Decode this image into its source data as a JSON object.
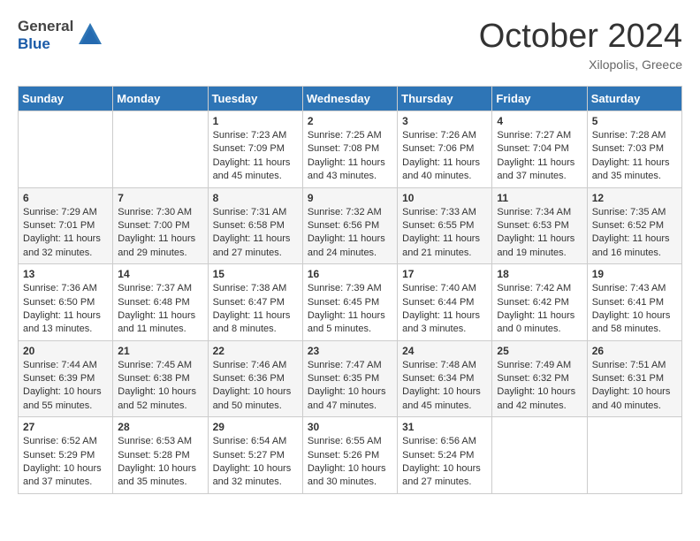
{
  "logo": {
    "general": "General",
    "blue": "Blue"
  },
  "title": {
    "month": "October 2024",
    "location": "Xilopolis, Greece"
  },
  "headers": [
    "Sunday",
    "Monday",
    "Tuesday",
    "Wednesday",
    "Thursday",
    "Friday",
    "Saturday"
  ],
  "weeks": [
    [
      {
        "day": "",
        "info": ""
      },
      {
        "day": "",
        "info": ""
      },
      {
        "day": "1",
        "info": "Sunrise: 7:23 AM\nSunset: 7:09 PM\nDaylight: 11 hours and 45 minutes."
      },
      {
        "day": "2",
        "info": "Sunrise: 7:25 AM\nSunset: 7:08 PM\nDaylight: 11 hours and 43 minutes."
      },
      {
        "day": "3",
        "info": "Sunrise: 7:26 AM\nSunset: 7:06 PM\nDaylight: 11 hours and 40 minutes."
      },
      {
        "day": "4",
        "info": "Sunrise: 7:27 AM\nSunset: 7:04 PM\nDaylight: 11 hours and 37 minutes."
      },
      {
        "day": "5",
        "info": "Sunrise: 7:28 AM\nSunset: 7:03 PM\nDaylight: 11 hours and 35 minutes."
      }
    ],
    [
      {
        "day": "6",
        "info": "Sunrise: 7:29 AM\nSunset: 7:01 PM\nDaylight: 11 hours and 32 minutes."
      },
      {
        "day": "7",
        "info": "Sunrise: 7:30 AM\nSunset: 7:00 PM\nDaylight: 11 hours and 29 minutes."
      },
      {
        "day": "8",
        "info": "Sunrise: 7:31 AM\nSunset: 6:58 PM\nDaylight: 11 hours and 27 minutes."
      },
      {
        "day": "9",
        "info": "Sunrise: 7:32 AM\nSunset: 6:56 PM\nDaylight: 11 hours and 24 minutes."
      },
      {
        "day": "10",
        "info": "Sunrise: 7:33 AM\nSunset: 6:55 PM\nDaylight: 11 hours and 21 minutes."
      },
      {
        "day": "11",
        "info": "Sunrise: 7:34 AM\nSunset: 6:53 PM\nDaylight: 11 hours and 19 minutes."
      },
      {
        "day": "12",
        "info": "Sunrise: 7:35 AM\nSunset: 6:52 PM\nDaylight: 11 hours and 16 minutes."
      }
    ],
    [
      {
        "day": "13",
        "info": "Sunrise: 7:36 AM\nSunset: 6:50 PM\nDaylight: 11 hours and 13 minutes."
      },
      {
        "day": "14",
        "info": "Sunrise: 7:37 AM\nSunset: 6:48 PM\nDaylight: 11 hours and 11 minutes."
      },
      {
        "day": "15",
        "info": "Sunrise: 7:38 AM\nSunset: 6:47 PM\nDaylight: 11 hours and 8 minutes."
      },
      {
        "day": "16",
        "info": "Sunrise: 7:39 AM\nSunset: 6:45 PM\nDaylight: 11 hours and 5 minutes."
      },
      {
        "day": "17",
        "info": "Sunrise: 7:40 AM\nSunset: 6:44 PM\nDaylight: 11 hours and 3 minutes."
      },
      {
        "day": "18",
        "info": "Sunrise: 7:42 AM\nSunset: 6:42 PM\nDaylight: 11 hours and 0 minutes."
      },
      {
        "day": "19",
        "info": "Sunrise: 7:43 AM\nSunset: 6:41 PM\nDaylight: 10 hours and 58 minutes."
      }
    ],
    [
      {
        "day": "20",
        "info": "Sunrise: 7:44 AM\nSunset: 6:39 PM\nDaylight: 10 hours and 55 minutes."
      },
      {
        "day": "21",
        "info": "Sunrise: 7:45 AM\nSunset: 6:38 PM\nDaylight: 10 hours and 52 minutes."
      },
      {
        "day": "22",
        "info": "Sunrise: 7:46 AM\nSunset: 6:36 PM\nDaylight: 10 hours and 50 minutes."
      },
      {
        "day": "23",
        "info": "Sunrise: 7:47 AM\nSunset: 6:35 PM\nDaylight: 10 hours and 47 minutes."
      },
      {
        "day": "24",
        "info": "Sunrise: 7:48 AM\nSunset: 6:34 PM\nDaylight: 10 hours and 45 minutes."
      },
      {
        "day": "25",
        "info": "Sunrise: 7:49 AM\nSunset: 6:32 PM\nDaylight: 10 hours and 42 minutes."
      },
      {
        "day": "26",
        "info": "Sunrise: 7:51 AM\nSunset: 6:31 PM\nDaylight: 10 hours and 40 minutes."
      }
    ],
    [
      {
        "day": "27",
        "info": "Sunrise: 6:52 AM\nSunset: 5:29 PM\nDaylight: 10 hours and 37 minutes."
      },
      {
        "day": "28",
        "info": "Sunrise: 6:53 AM\nSunset: 5:28 PM\nDaylight: 10 hours and 35 minutes."
      },
      {
        "day": "29",
        "info": "Sunrise: 6:54 AM\nSunset: 5:27 PM\nDaylight: 10 hours and 32 minutes."
      },
      {
        "day": "30",
        "info": "Sunrise: 6:55 AM\nSunset: 5:26 PM\nDaylight: 10 hours and 30 minutes."
      },
      {
        "day": "31",
        "info": "Sunrise: 6:56 AM\nSunset: 5:24 PM\nDaylight: 10 hours and 27 minutes."
      },
      {
        "day": "",
        "info": ""
      },
      {
        "day": "",
        "info": ""
      }
    ]
  ]
}
